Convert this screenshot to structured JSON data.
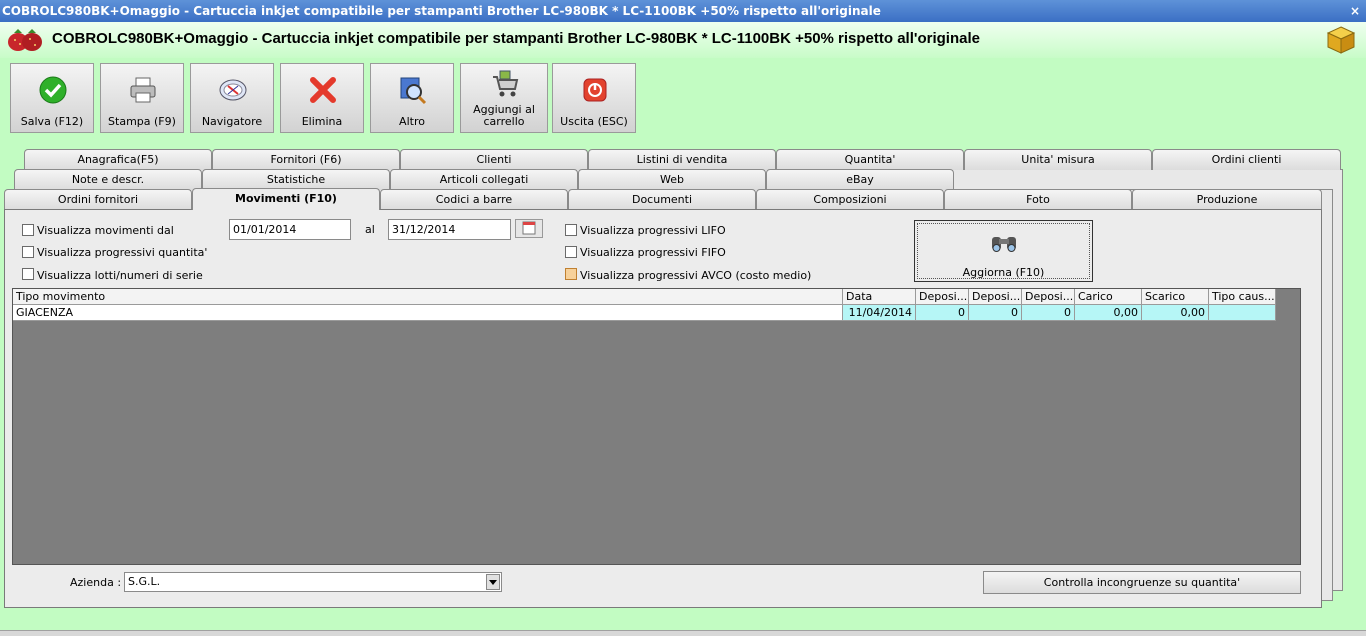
{
  "window": {
    "title": "COBROLC980BK+Omaggio - Cartuccia inkjet compatibile per stampanti Brother LC-980BK * LC-1100BK +50% rispetto all'originale",
    "close": "×"
  },
  "header": {
    "title": "COBROLC980BK+Omaggio - Cartuccia inkjet compatibile per stampanti Brother LC-980BK * LC-1100BK +50% rispetto all'originale"
  },
  "toolbar": {
    "save": "Salva (F12)",
    "print": "Stampa (F9)",
    "navigator": "Navigatore",
    "delete": "Elimina",
    "other": "Altro",
    "add_cart_1": "Aggiungi al",
    "add_cart_2": "carrello",
    "exit": "Uscita (ESC)"
  },
  "tabs": {
    "row1": [
      "Anagrafica(F5)",
      "Fornitori (F6)",
      "Clienti",
      "Listini di vendita",
      "Quantita'",
      "Unita' misura",
      "Ordini clienti"
    ],
    "row2": [
      "Note e descr.",
      "Statistiche",
      "Articoli collegati",
      "Web",
      "eBay"
    ],
    "row3": [
      "Ordini fornitori",
      "Movimenti (F10)",
      "Codici a barre",
      "Documenti",
      "Composizioni",
      "Foto",
      "Produzione"
    ]
  },
  "filters": {
    "show_movements": "Visualizza movimenti dal",
    "show_progressive_qty": "Visualizza progressivi quantita'",
    "show_lots": "Visualizza lotti/numeri di serie",
    "date_from": "01/01/2014",
    "to_label": "al",
    "date_to": "31/12/2014",
    "lifo": "Visualizza progressivi LIFO",
    "fifo": "Visualizza progressivi FIFO",
    "avco": "Visualizza progressivi AVCO (costo medio)",
    "refresh": "Aggiorna (F10)"
  },
  "table": {
    "columns": [
      "Tipo movimento",
      "Data",
      "Deposi...",
      "Deposi...",
      "Deposi...",
      "Carico",
      "Scarico",
      "Tipo caus..."
    ],
    "rows": [
      [
        "GIACENZA",
        "11/04/2014",
        "0",
        "0",
        "0",
        "0,00",
        "0,00",
        ""
      ]
    ]
  },
  "footer": {
    "company_label": "Azienda :",
    "company_value": "S.G.L.",
    "check_button": "Controlla incongruenze su quantita'"
  },
  "colors": {
    "background": "#c2fcc2",
    "titlebar": "#3b6fc4",
    "grid_empty": "#7e7e7e",
    "row_highlight": "#b6f6f6"
  }
}
